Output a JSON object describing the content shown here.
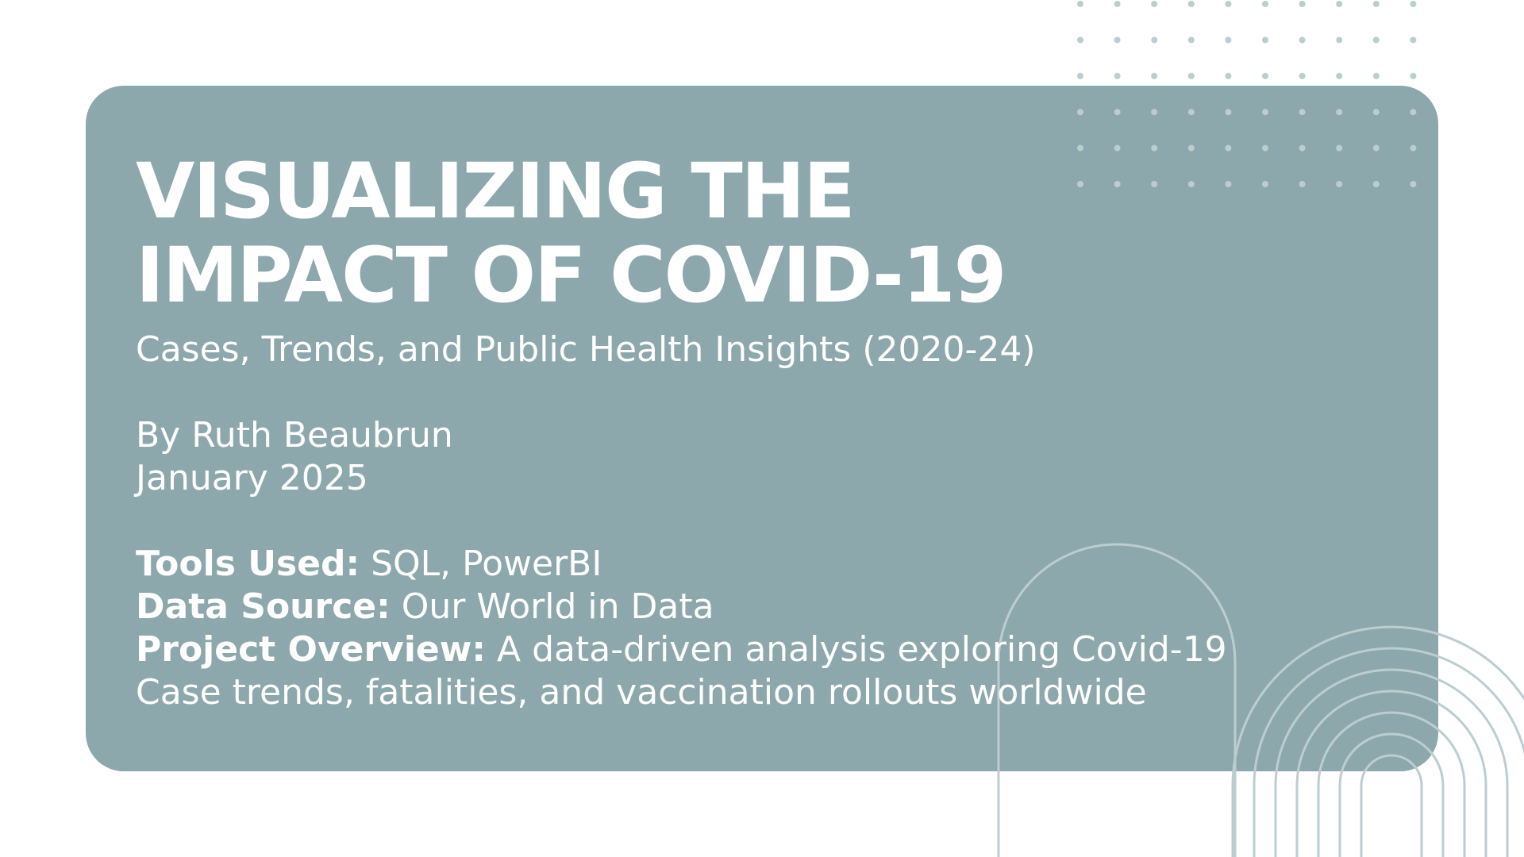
{
  "slide": {
    "title_line1": "VISUALIZING THE",
    "title_line2": "IMPACT OF COVID-19",
    "subtitle": "Cases, Trends, and Public Health Insights (2020-24)",
    "author": "By Ruth Beaubrun",
    "date": "January 2025",
    "details": [
      {
        "label": "Tools Used:",
        "value": "SQL, PowerBI"
      },
      {
        "label": "Data Source:",
        "value": "Our World in Data"
      },
      {
        "label": "Project Overview:",
        "value": "A data-driven analysis exploring Covid-19"
      }
    ],
    "overview_continued": "Case trends, fatalities, and vaccination rollouts worldwide"
  },
  "colors": {
    "card": "#8ca8ac",
    "text": "#ffffff",
    "decoration": "#bccdd0",
    "background": "#ffffff"
  }
}
